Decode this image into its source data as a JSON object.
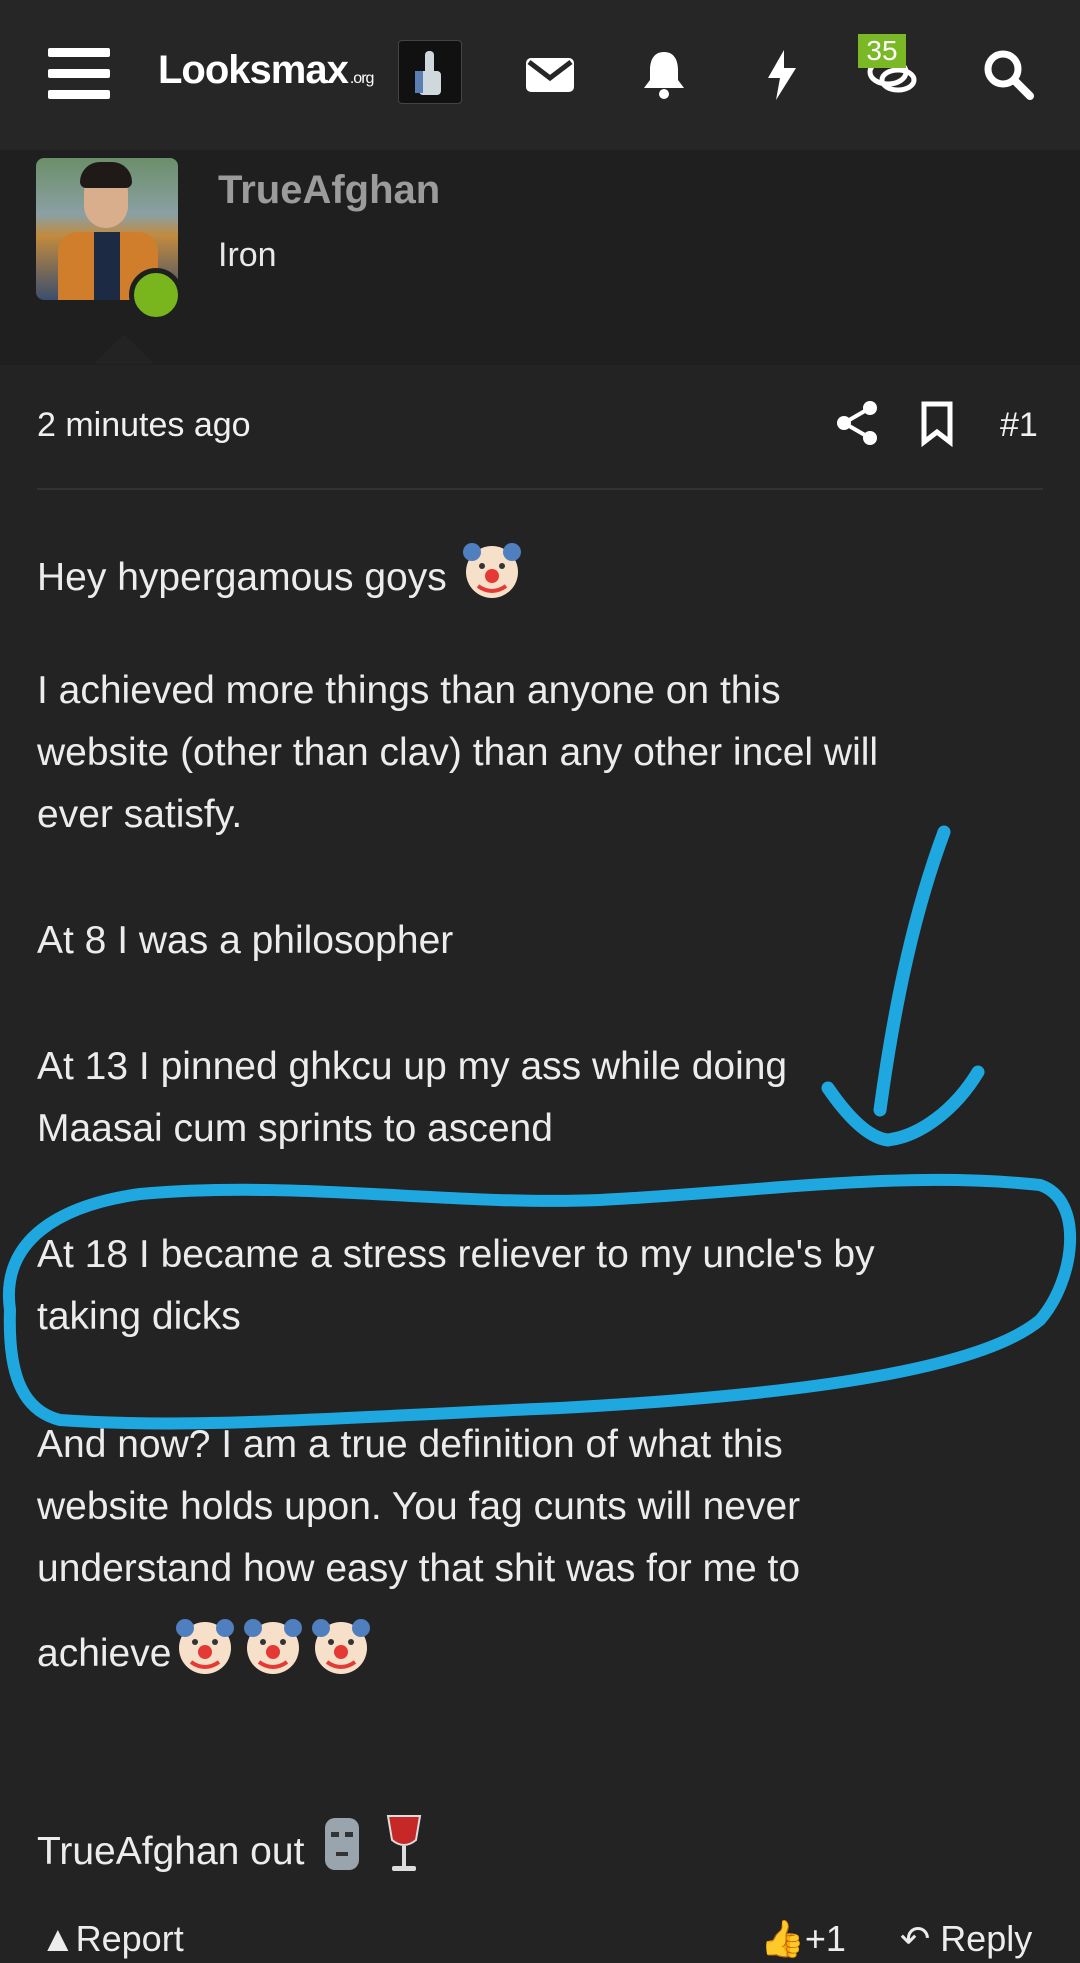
{
  "nav": {
    "logo_main": "Looksmax",
    "logo_suffix": ".org",
    "conversations_badge": "35"
  },
  "author": {
    "username": "TrueAfghan",
    "title": "Iron",
    "online": true
  },
  "post": {
    "timestamp": "2 minutes ago",
    "post_number": "#1",
    "paragraphs": [
      "Hey hypergamous goys",
      "I achieved more things than anyone on this",
      "website (other than clav) than any other incel will",
      "ever satisfy.",
      "At 8 I was a philosopher",
      "At 13 I pinned ghkcu up my ass while doing",
      "Maasai cum sprints to ascend",
      "At 18 I became a stress reliever to my uncle's by",
      "taking dicks",
      "And now? I am a true definition of what this",
      "website holds upon. You fag cunts will never",
      "understand how easy that shit was for me to",
      "achieve",
      "TrueAfghan out"
    ]
  },
  "actions": {
    "report": "Report",
    "like": "+1",
    "reply": "Reply"
  },
  "annotation_color": "#1fa8e0"
}
